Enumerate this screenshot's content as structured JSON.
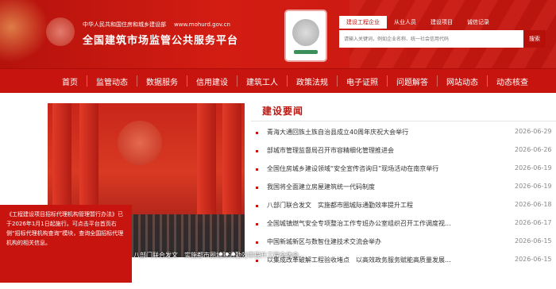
{
  "header": {
    "org_name": "中华人民共和国住房和城乡建设部",
    "org_url": "www.mohurd.gov.cn",
    "site_title": "全国建筑市场监管公共服务平台"
  },
  "search": {
    "tabs": [
      "建设工程企业",
      "从业人员",
      "建设项目",
      "诚信记录"
    ],
    "active_tab": "建设工程企业",
    "placeholder": "请输入关键词，例如企业名称、统一社会信用代码",
    "button_label": "搜索"
  },
  "nav": {
    "items": [
      "首页",
      "监管动态",
      "数据服务",
      "信用建设",
      "建筑工人",
      "政策法规",
      "电子证照",
      "问题解答",
      "网站动态",
      "动态核查"
    ]
  },
  "feature": {
    "caption": "八部门联合发文　实施都市圈城际通勤效率提升工程全体会..."
  },
  "notice": {
    "text": "《工程建设项目招标代理机构管理暂行办法》已于2026年1月1日起施行。可点击平台首页右侧“招标代理机构查询”模块，查询全国招标代理机构的相关信息。"
  },
  "news": {
    "title": "建设要闻",
    "items": [
      {
        "text": "青海大通回族土族自治县成立40周年庆祝大会举行",
        "date": "2026-06-29"
      },
      {
        "text": "部城市管理监督局召开市容精细化管理推进会",
        "date": "2026-06-26"
      },
      {
        "text": "全国住房城乡建设领域“安全宣传咨询日”现场活动在南京举行",
        "date": "2026-06-19"
      },
      {
        "text": "我国将全面建立房屋建筑统一代码制度",
        "date": "2026-06-19"
      },
      {
        "text": "八部门联合发文　实施都市圈城际通勤效率提升工程",
        "date": "2026-06-18"
      },
      {
        "text": "全国城镇燃气安全专项整治工作专班办公室组织召开工作调度视...",
        "date": "2026-06-17"
      },
      {
        "text": "中国新城新区与数智住建技术交流会举办",
        "date": "2026-06-15"
      },
      {
        "text": "以集成改革破解工程验收堵点　以高效政务服务赋能高质量发展...",
        "date": "2026-06-15"
      }
    ]
  }
}
